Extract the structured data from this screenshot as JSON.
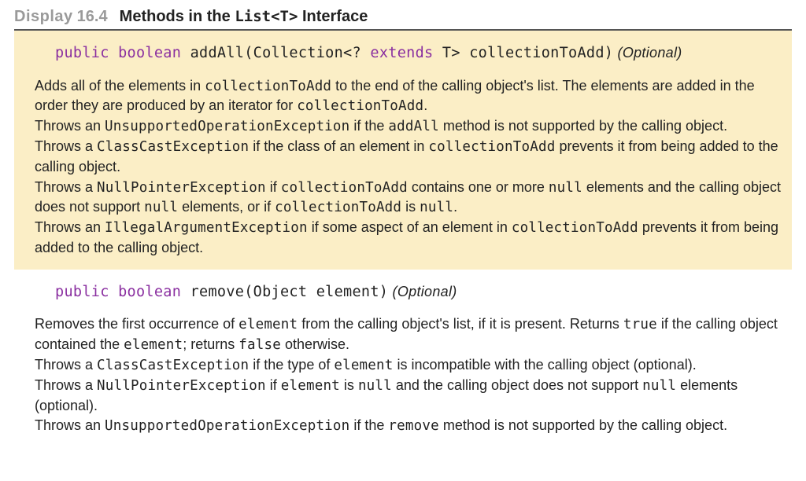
{
  "header": {
    "display_word": "Display",
    "display_number": "16.4",
    "title_before_code": "Methods in the ",
    "title_code": "List<T>",
    "title_after_code": " Interface"
  },
  "methods": [
    {
      "highlight": true,
      "sig": {
        "kw1": "public",
        "kw2": "boolean",
        "part1": " addAll(Collection<? ",
        "kw3": "extends",
        "part2": " T> collectionToAdd)",
        "optional": " (Optional)"
      },
      "desc": [
        {
          "runs": [
            {
              "t": "Adds all of the elements in "
            },
            {
              "t": "collectionToAdd",
              "mono": true
            },
            {
              "t": " to the end of the calling object's list. The elements are added in the order they are produced by an iterator for "
            },
            {
              "t": "collectionToAdd",
              "mono": true
            },
            {
              "t": "."
            }
          ]
        },
        {
          "runs": [
            {
              "t": "Throws an "
            },
            {
              "t": "UnsupportedOperationException",
              "mono": true
            },
            {
              "t": " if the "
            },
            {
              "t": "addAll",
              "mono": true
            },
            {
              "t": " method is not supported by the calling object."
            }
          ]
        },
        {
          "runs": [
            {
              "t": "Throws a "
            },
            {
              "t": "ClassCastException",
              "mono": true
            },
            {
              "t": " if the class of an element in "
            },
            {
              "t": "collectionToAdd",
              "mono": true
            },
            {
              "t": " prevents it from being added to the calling object."
            }
          ]
        },
        {
          "runs": [
            {
              "t": "Throws a "
            },
            {
              "t": "NullPointerException",
              "mono": true
            },
            {
              "t": " if "
            },
            {
              "t": "collectionToAdd",
              "mono": true
            },
            {
              "t": " contains one or more "
            },
            {
              "t": "null",
              "mono": true
            },
            {
              "t": " elements and the calling object does not support "
            },
            {
              "t": "null",
              "mono": true
            },
            {
              "t": " elements, or if "
            },
            {
              "t": "collectionToAdd",
              "mono": true
            },
            {
              "t": " is "
            },
            {
              "t": "null",
              "mono": true
            },
            {
              "t": "."
            }
          ]
        },
        {
          "runs": [
            {
              "t": "Throws an "
            },
            {
              "t": "IllegalArgumentException",
              "mono": true
            },
            {
              "t": " if some aspect of an element in "
            },
            {
              "t": "collectionToAdd",
              "mono": true
            },
            {
              "t": " prevents it from being added to the calling object."
            }
          ]
        }
      ]
    },
    {
      "highlight": false,
      "sig": {
        "kw1": "public",
        "kw2": "boolean",
        "part1": " remove(Object element)",
        "kw3": "",
        "part2": "",
        "optional": " (Optional)"
      },
      "desc": [
        {
          "runs": [
            {
              "t": "Removes the first occurrence of "
            },
            {
              "t": "element",
              "mono": true
            },
            {
              "t": " from the calling object's list, if it is present. Returns "
            },
            {
              "t": "true",
              "mono": true
            },
            {
              "t": " if the calling object contained the "
            },
            {
              "t": "element",
              "mono": true
            },
            {
              "t": "; returns "
            },
            {
              "t": "false",
              "mono": true
            },
            {
              "t": " otherwise."
            }
          ]
        },
        {
          "runs": [
            {
              "t": "Throws a "
            },
            {
              "t": "ClassCastException",
              "mono": true
            },
            {
              "t": " if the type of "
            },
            {
              "t": "element",
              "mono": true
            },
            {
              "t": " is incompatible with the calling object (optional)."
            }
          ]
        },
        {
          "runs": [
            {
              "t": "Throws a "
            },
            {
              "t": "NullPointerException",
              "mono": true
            },
            {
              "t": " if "
            },
            {
              "t": "element",
              "mono": true
            },
            {
              "t": " is "
            },
            {
              "t": "null",
              "mono": true
            },
            {
              "t": " and the calling object does not support "
            },
            {
              "t": "null",
              "mono": true
            },
            {
              "t": " elements (optional)."
            }
          ]
        },
        {
          "runs": [
            {
              "t": "Throws an "
            },
            {
              "t": "UnsupportedOperationException",
              "mono": true
            },
            {
              "t": " if the "
            },
            {
              "t": "remove",
              "mono": true
            },
            {
              "t": " method is not supported by the calling object."
            }
          ]
        }
      ]
    }
  ]
}
